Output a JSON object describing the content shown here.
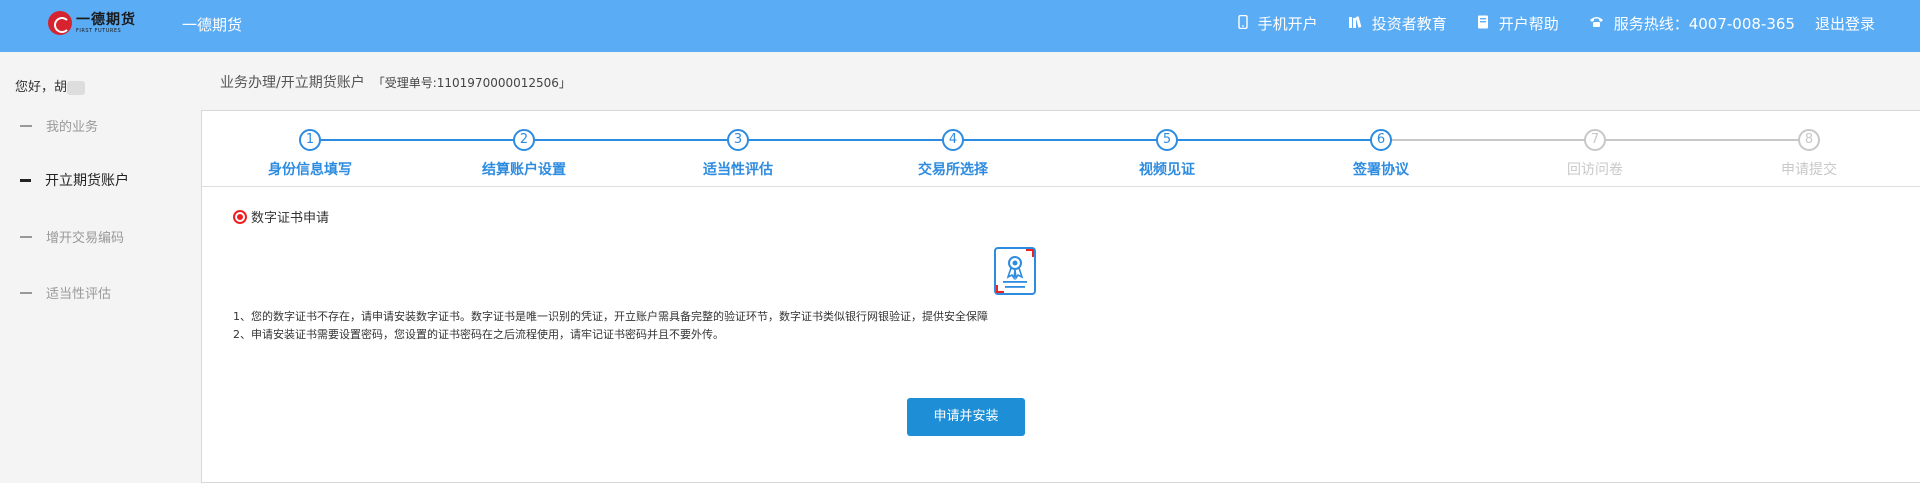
{
  "header": {
    "logo_cn": "一德期货",
    "logo_en": "FIRST FUTURES",
    "brand": "一德期货",
    "nav": [
      {
        "icon": "mobile-icon",
        "label": "手机开户"
      },
      {
        "icon": "books-icon",
        "label": "投资者教育"
      },
      {
        "icon": "book-icon",
        "label": "开户帮助"
      },
      {
        "icon": "phone-icon",
        "label": "服务热线：4007-008-365"
      }
    ],
    "logout": "退出登录"
  },
  "sidebar": {
    "greeting": "您好，胡",
    "items": [
      {
        "label": "我的业务",
        "active": false
      },
      {
        "label": "开立期货账户",
        "active": true
      },
      {
        "label": "增开交易编码",
        "active": false
      },
      {
        "label": "适当性评估",
        "active": false
      }
    ]
  },
  "breadcrumb": {
    "path": "业务办理/开立期货账户",
    "order": "「受理单号:1101970000012506」"
  },
  "steps": [
    {
      "num": "1",
      "label": "身份信息填写",
      "done": true
    },
    {
      "num": "2",
      "label": "结算账户设置",
      "done": true
    },
    {
      "num": "3",
      "label": "适当性评估",
      "done": true
    },
    {
      "num": "4",
      "label": "交易所选择",
      "done": true
    },
    {
      "num": "5",
      "label": "视频见证",
      "done": true
    },
    {
      "num": "6",
      "label": "签署协议",
      "done": true
    },
    {
      "num": "7",
      "label": "回访问卷",
      "done": false
    },
    {
      "num": "8",
      "label": "申请提交",
      "done": false
    }
  ],
  "content": {
    "section_title": "数字证书申请",
    "notes": [
      "1、您的数字证书不存在，请申请安装数字证书。数字证书是唯一识别的凭证，开立账户需具备完整的验证环节，数字证书类似银行网银验证，提供安全保障",
      "2、申请安装证书需要设置密码，您设置的证书密码在之后流程使用，请牢记证书密码并且不要外传。"
    ],
    "apply_button": "申请并安装"
  },
  "colors": {
    "header_bg": "#5aacf5",
    "step_active": "#2e8ce0",
    "step_todo": "#c8c8c8",
    "button": "#1e8fd6"
  }
}
